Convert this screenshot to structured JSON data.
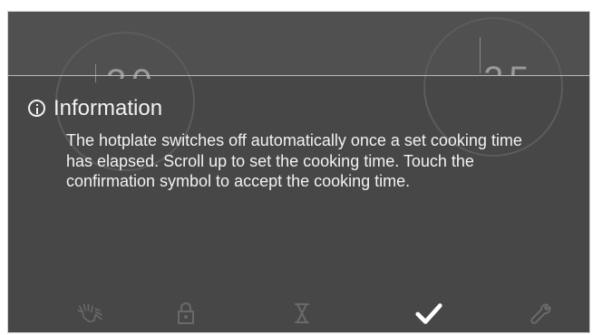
{
  "dials": {
    "left": {
      "value": "30"
    },
    "right": {
      "value": "25"
    }
  },
  "info": {
    "title": "Information",
    "body": "The hotplate switches off automatically once a set cooking time has elapsed. Scroll up to set the cooking time. Touch the confirmation symbol to accept the cooking time."
  },
  "toolbar": {
    "items": [
      "wipe-protection-hand-icon",
      "lock-icon",
      "timer-hourglass-icon",
      "confirm-check-icon",
      "settings-wrench-icon"
    ]
  }
}
